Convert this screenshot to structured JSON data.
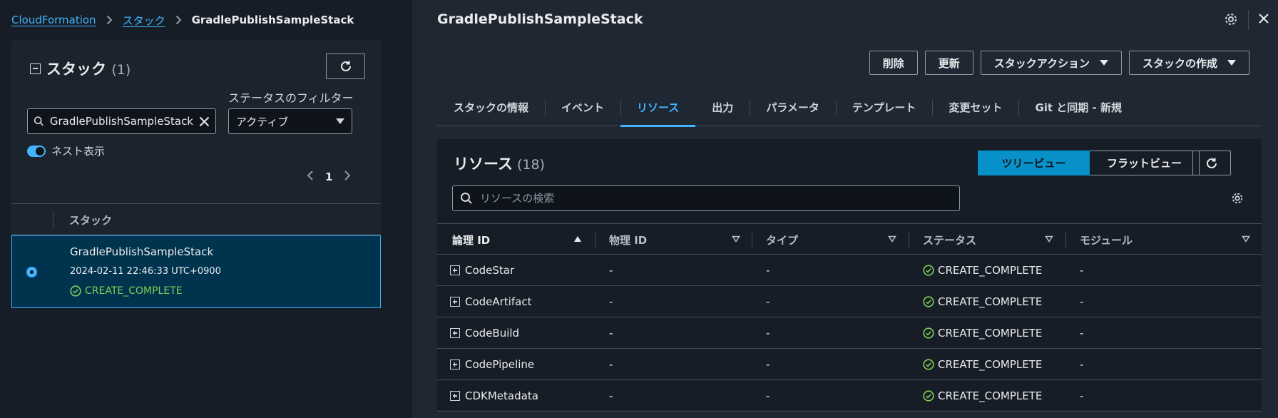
{
  "breadcrumb": {
    "root": "CloudFormation",
    "stacks": "スタック",
    "current": "GradlePublishSampleStack"
  },
  "stack_panel": {
    "title": "スタック",
    "count": "(1)",
    "filter_label": "ステータスのフィルター",
    "search_value": "GradlePublishSampleStack",
    "filter_value": "アクティブ",
    "nested_toggle_label": "ネスト表示",
    "nested_toggle_on": true,
    "page": "1",
    "column_header": "スタック",
    "rows": [
      {
        "name": "GradlePublishSampleStack",
        "date": "2024-02-11 22:46:33 UTC+0900",
        "status": "CREATE_COMPLETE",
        "selected": true
      }
    ]
  },
  "detail": {
    "title": "GradlePublishSampleStack",
    "actions": {
      "delete": "削除",
      "update": "更新",
      "stack_actions": "スタックアクション",
      "create_stack": "スタックの作成"
    },
    "tabs": [
      {
        "label": "スタックの情報",
        "active": false
      },
      {
        "label": "イベント",
        "active": false
      },
      {
        "label": "リソース",
        "active": true
      },
      {
        "label": "出力",
        "active": false
      },
      {
        "label": "パラメータ",
        "active": false
      },
      {
        "label": "テンプレート",
        "active": false
      },
      {
        "label": "変更セット",
        "active": false
      },
      {
        "label": "Git と同期 - 新規",
        "active": false
      }
    ]
  },
  "resources": {
    "title": "リソース",
    "count": "(18)",
    "tree_view": "ツリービュー",
    "flat_view": "フラットビュー",
    "search_placeholder": "リソースの検索",
    "columns": [
      "論理 ID",
      "物理 ID",
      "タイプ",
      "ステータス",
      "モジュール"
    ],
    "rows": [
      {
        "logical_id": "CodeStar",
        "physical_id": "-",
        "type": "-",
        "status": "CREATE_COMPLETE",
        "module": "-"
      },
      {
        "logical_id": "CodeArtifact",
        "physical_id": "-",
        "type": "-",
        "status": "CREATE_COMPLETE",
        "module": "-"
      },
      {
        "logical_id": "CodeBuild",
        "physical_id": "-",
        "type": "-",
        "status": "CREATE_COMPLETE",
        "module": "-"
      },
      {
        "logical_id": "CodePipeline",
        "physical_id": "-",
        "type": "-",
        "status": "CREATE_COMPLETE",
        "module": "-"
      },
      {
        "logical_id": "CDKMetadata",
        "physical_id": "-",
        "type": "-",
        "status": "CREATE_COMPLETE",
        "module": "-"
      }
    ]
  },
  "colors": {
    "accent": "#42b4ff",
    "success": "#7fd057",
    "selected_row_bg": "#00334d",
    "active_segment": "#0891c9"
  }
}
